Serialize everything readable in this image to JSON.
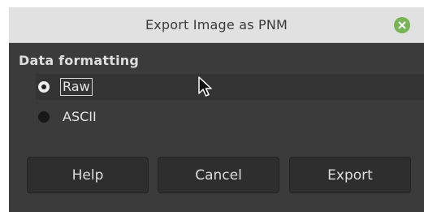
{
  "window": {
    "title": "Export Image as PNM",
    "close_icon": "close-icon"
  },
  "data_formatting": {
    "label": "Data formatting",
    "options": [
      {
        "label": "Raw",
        "selected": true
      },
      {
        "label": "ASCII",
        "selected": false
      }
    ]
  },
  "buttons": {
    "help": "Help",
    "cancel": "Cancel",
    "export": "Export"
  },
  "colors": {
    "dialog_bg": "#3b3b3b",
    "titlebar_bg": "#e1e1e1",
    "close_green": "#77b456"
  }
}
